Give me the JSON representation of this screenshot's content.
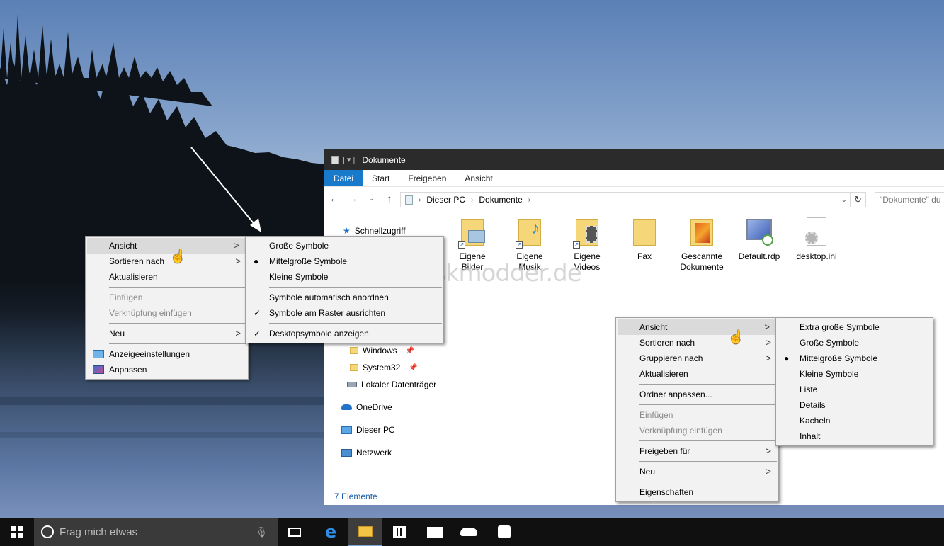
{
  "window": {
    "title": "Dokumente",
    "ribbon_tabs": [
      "Datei",
      "Start",
      "Freigeben",
      "Ansicht"
    ],
    "breadcrumb": [
      "Dieser PC",
      "Dokumente"
    ],
    "search_placeholder": "\"Dokumente\" du",
    "status": "7 Elemente"
  },
  "nav": {
    "quick_access": "Schnellzugriff",
    "items": [
      {
        "label": "Windows",
        "icon": "folder-icon",
        "pinned": true
      },
      {
        "label": "System32",
        "icon": "folder-icon",
        "pinned": true
      },
      {
        "label": "Lokaler Datenträger",
        "icon": "drive-icon",
        "pinned": false
      },
      {
        "label": "OneDrive",
        "icon": "onedrive-icon"
      },
      {
        "label": "Dieser PC",
        "icon": "pc-icon"
      },
      {
        "label": "Netzwerk",
        "icon": "network-icon"
      }
    ]
  },
  "files": [
    {
      "name": "Eigene\nBilder",
      "icon": "pictures-folder-icon"
    },
    {
      "name": "Eigene\nMusik",
      "icon": "music-folder-icon"
    },
    {
      "name": "Eigene\nVideos",
      "icon": "videos-folder-icon"
    },
    {
      "name": "Fax",
      "icon": "folder-icon"
    },
    {
      "name": "Gescannte\nDokumente",
      "icon": "scanned-folder-icon"
    },
    {
      "name": "Default.rdp",
      "icon": "rdp-file-icon"
    },
    {
      "name": "desktop.ini",
      "icon": "ini-file-icon"
    }
  ],
  "watermark": "Deskmodder.de",
  "desktop_menu": {
    "items": [
      "Ansicht",
      "Sortieren nach",
      "Aktualisieren",
      "Einfügen",
      "Verknüpfung einfügen",
      "Neu",
      "Anzeigeeinstellungen",
      "Anpassen"
    ]
  },
  "desktop_submenu": {
    "items": [
      "Große Symbole",
      "Mittelgroße Symbole",
      "Kleine Symbole",
      "Symbole automatisch anordnen",
      "Symbole am Raster ausrichten",
      "Desktopsymbole anzeigen"
    ],
    "selected": "Mittelgroße Symbole"
  },
  "explorer_menu": {
    "items": [
      "Ansicht",
      "Sortieren nach",
      "Gruppieren nach",
      "Aktualisieren",
      "Ordner anpassen...",
      "Einfügen",
      "Verknüpfung einfügen",
      "Freigeben für",
      "Neu",
      "Eigenschaften"
    ]
  },
  "explorer_submenu": {
    "items": [
      "Extra große Symbole",
      "Große Symbole",
      "Mittelgroße Symbole",
      "Kleine Symbole",
      "Liste",
      "Details",
      "Kacheln",
      "Inhalt"
    ],
    "selected": "Mittelgroße Symbole"
  },
  "taskbar": {
    "search_placeholder": "Frag mich etwas",
    "icons": [
      "start-icon",
      "cortana-icon",
      "microphone-icon",
      "task-view-icon",
      "edge-icon",
      "file-explorer-icon",
      "store-icon",
      "mail-icon",
      "onedrive-icon",
      "feedback-icon"
    ]
  },
  "colors": {
    "accent": "#1979ca",
    "taskbar": "#101010",
    "menu_bg": "#f2f2f2",
    "menu_highlight": "#dadada"
  }
}
